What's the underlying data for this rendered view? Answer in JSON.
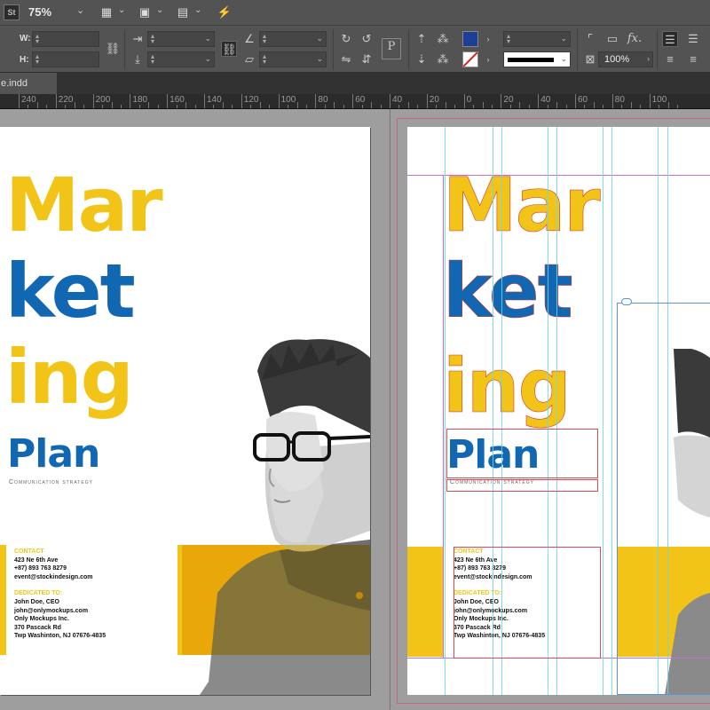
{
  "appbar": {
    "logo": "St",
    "zoom": "75%"
  },
  "control": {
    "w_label": "W:",
    "h_label": "H:",
    "percent_value": "100%",
    "fx_label": "fx."
  },
  "tabs": [
    {
      "label": "e.indd"
    }
  ],
  "ruler": {
    "numbers": [
      "240",
      "220",
      "200",
      "180",
      "160",
      "140",
      "120",
      "100",
      "80",
      "60",
      "40",
      "20",
      "0",
      "20",
      "40",
      "60",
      "80",
      "100"
    ]
  },
  "colors": {
    "yellow": "#f2c417",
    "blue": "#1167b1",
    "fill_swatch": "#1f3f93"
  },
  "document": {
    "title_line1": "Mar",
    "title_line2": "ket",
    "title_line3": "ing",
    "title_line4": "Plan",
    "subtitle": "Communication strategy",
    "contact_heading": "CONTACT",
    "contact_lines": [
      "423 Ne 6th Ave",
      "+87) 893 763 8279",
      "event@stockindesign.com"
    ],
    "dedicated_heading": "DEDICATED TO:",
    "dedicated_lines": [
      "John Doe, CEO",
      "john@onlymockups.com",
      "Only Mockups Inc.",
      "370 Pascack Rd",
      "Twp Washinton, NJ 07676-4835"
    ]
  }
}
